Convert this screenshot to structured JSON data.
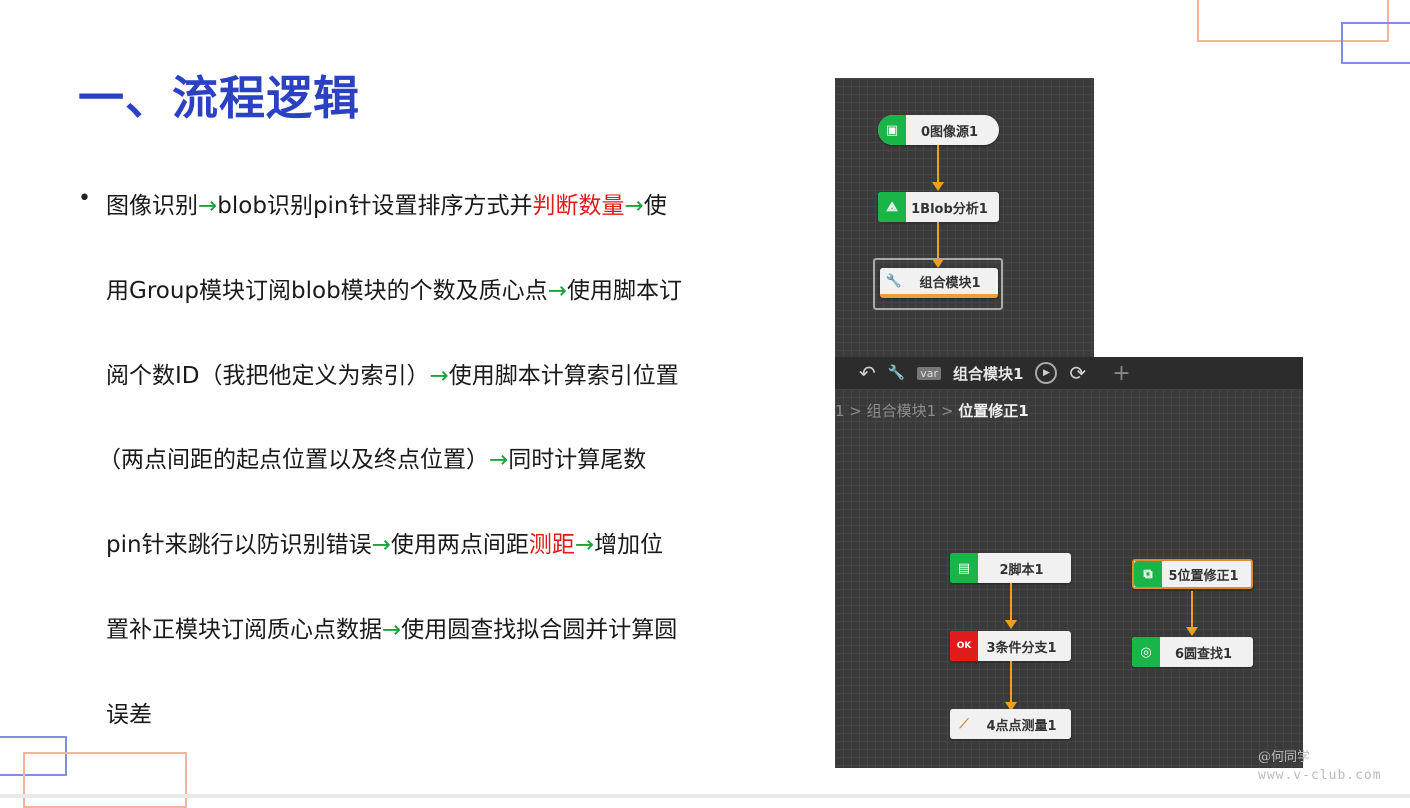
{
  "slide": {
    "title": "一、流程逻辑",
    "bullet_symbol": "•",
    "lines": [
      [
        {
          "t": "图像识别"
        },
        {
          "t": "→",
          "c": "ar"
        },
        {
          "t": "blob识别pin针设置排序方式并"
        },
        {
          "t": "判断数量",
          "c": "rd"
        },
        {
          "t": "→",
          "c": "ar"
        },
        {
          "t": "使"
        }
      ],
      [
        {
          "t": "用Group模块订阅blob模块的个数及质心点"
        },
        {
          "t": "→",
          "c": "ar"
        },
        {
          "t": "使用脚本订"
        }
      ],
      [
        {
          "t": "阅个数ID（我把他定义为索引）"
        },
        {
          "t": "→",
          "c": "ar"
        },
        {
          "t": "使用脚本计算索引位置"
        }
      ],
      [
        {
          "t": "（两点间距的起点位置以及终点位置）"
        },
        {
          "t": "→",
          "c": "ar"
        },
        {
          "t": "同时计算尾数"
        }
      ],
      [
        {
          "t": "pin针来跳行以防识别错误"
        },
        {
          "t": "→",
          "c": "ar"
        },
        {
          "t": "使用两点间距"
        },
        {
          "t": "测距",
          "c": "rd"
        },
        {
          "t": "→",
          "c": "ar"
        },
        {
          "t": "增加位"
        }
      ],
      [
        {
          "t": "置补正模块订阅质心点数据"
        },
        {
          "t": "→",
          "c": "ar"
        },
        {
          "t": "使用圆查找拟合圆并计算圆"
        }
      ],
      [
        {
          "t": "误差"
        }
      ]
    ]
  },
  "flow_top": {
    "nodes": [
      {
        "label": "0图像源1",
        "icon": "image-icon"
      },
      {
        "label": "1Blob分析1",
        "icon": "blob-icon"
      },
      {
        "label": "组合模块1",
        "icon": "wrench-icon"
      }
    ]
  },
  "flow_bottom": {
    "toolbar": {
      "back": "↶",
      "wrench": "🔧",
      "var": "var",
      "group_name": "组合模块1",
      "play": "▶",
      "loop": "⟳",
      "add": "+"
    },
    "breadcrumb": {
      "prefix": "1 > 组合模块1 > ",
      "current": "位置修正1"
    },
    "nodes": [
      {
        "label": "2脚本1",
        "icon": "script-icon"
      },
      {
        "label": "3条件分支1",
        "icon": "branch-icon"
      },
      {
        "label": "4点点测量1",
        "icon": "measure-icon"
      },
      {
        "label": "5位置修正1",
        "icon": "position-correct-icon"
      },
      {
        "label": "6圆查找1",
        "icon": "circle-find-icon"
      }
    ]
  },
  "watermark": {
    "line1": "@何同学",
    "line2": "www.v-club.com"
  },
  "colors": {
    "title": "#2b41c4",
    "arrow": "#1aa33a",
    "highlight": "#e21a1a",
    "deco_orange": "#f4b49a",
    "deco_blue": "#7f8fe0"
  }
}
